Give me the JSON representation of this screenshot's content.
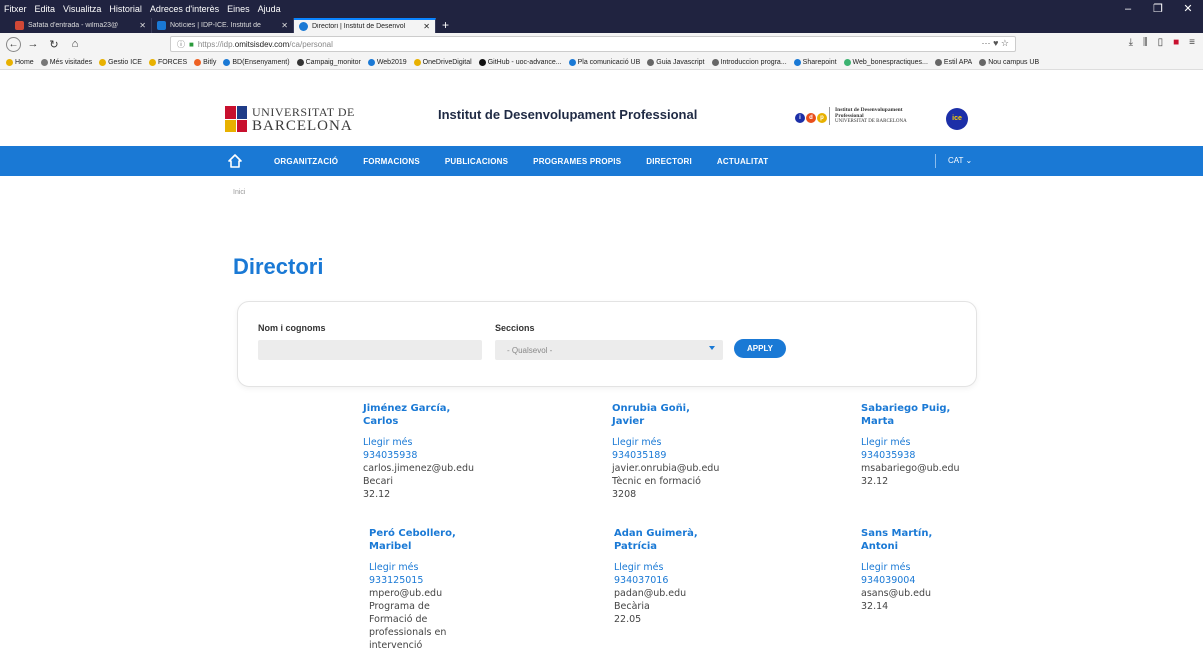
{
  "browser": {
    "menu": [
      "Fitxer",
      "Edita",
      "Visualitza",
      "Historial",
      "Adreces d'interès",
      "Eines",
      "Ajuda"
    ],
    "tabs": [
      {
        "title": "Safata d'entrada - wilma23@",
        "color": "#d14836"
      },
      {
        "title": "Notícies | IDP-ICE. Institut de",
        "color": "#1a79d5"
      },
      {
        "title": "Directori | Institut de Desenvol",
        "color": "#1a79d5"
      }
    ],
    "url_prefix": "https://idp.",
    "url_host": "omitsisdev.com",
    "url_path": "/ca/personal",
    "bookmarks": [
      "Home",
      "Més visitades",
      "Gestio ICE",
      "FORCES",
      "Bitly",
      "BD(Ensenyament)",
      "Campaig_monitor",
      "Web2019",
      "OneDriveDigital",
      "GitHub - uoc-advance...",
      "Pla comunicació UB",
      "Guia Javascript",
      "Introduccion progra...",
      "Sharepoint",
      "Web_bonespractiques...",
      "Estil APA",
      "Nou campus UB"
    ]
  },
  "header": {
    "ub_line1": "UNIVERSITAT DE",
    "ub_line2": "BARCELONA",
    "institute_title": "Institut de Desenvolupament Professional",
    "idp_line1": "Institut de Desenvolupament",
    "idp_line2": "Professional",
    "idp_line3": "UNIVERSITAT DE BARCELONA",
    "ice": "ice"
  },
  "nav": {
    "items": [
      "ORGANITZACIÓ",
      "FORMACIONS",
      "PUBLICACIONS",
      "PROGRAMES PROPIS",
      "DIRECTORI",
      "ACTUALITAT"
    ],
    "lang": "CAT ⌄"
  },
  "breadcrumb": "Inici",
  "page_title": "Directori",
  "filter": {
    "name_label": "Nom i cognoms",
    "section_label": "Seccions",
    "select_value": "- Qualsevol -",
    "apply_label": "APPLY"
  },
  "people": [
    {
      "name": "Jiménez García, Carlos",
      "more": "Llegir més",
      "phone": "934035938",
      "email": "carlos.jimenez@ub.edu",
      "role": "Becari",
      "room": "32.12"
    },
    {
      "name": "Onrubia Goñi, Javier",
      "more": "Llegir més",
      "phone": "934035189",
      "email": "javier.onrubia@ub.edu",
      "role": "Tècnic en formació",
      "room": "3208"
    },
    {
      "name": "Sabariego Puig, Marta",
      "more": "Llegir més",
      "phone": "934035938",
      "email": "msabariego@ub.edu",
      "role": "",
      "room": "32.12"
    },
    {
      "name": "Peró Cebollero, Maribel",
      "more": "Llegir més",
      "phone": "933125015",
      "email": "mpero@ub.edu",
      "role": "Programa de Formació de professionals en intervenció",
      "room": ""
    },
    {
      "name": "Adan Guimerà, Patrícia",
      "more": "Llegir més",
      "phone": "934037016",
      "email": "padan@ub.edu",
      "role": "Becària",
      "room": "22.05"
    },
    {
      "name": "Sans Martín, Antoni",
      "more": "Llegir més",
      "phone": "934039004",
      "email": "asans@ub.edu",
      "role": "",
      "room": "32.14"
    }
  ]
}
